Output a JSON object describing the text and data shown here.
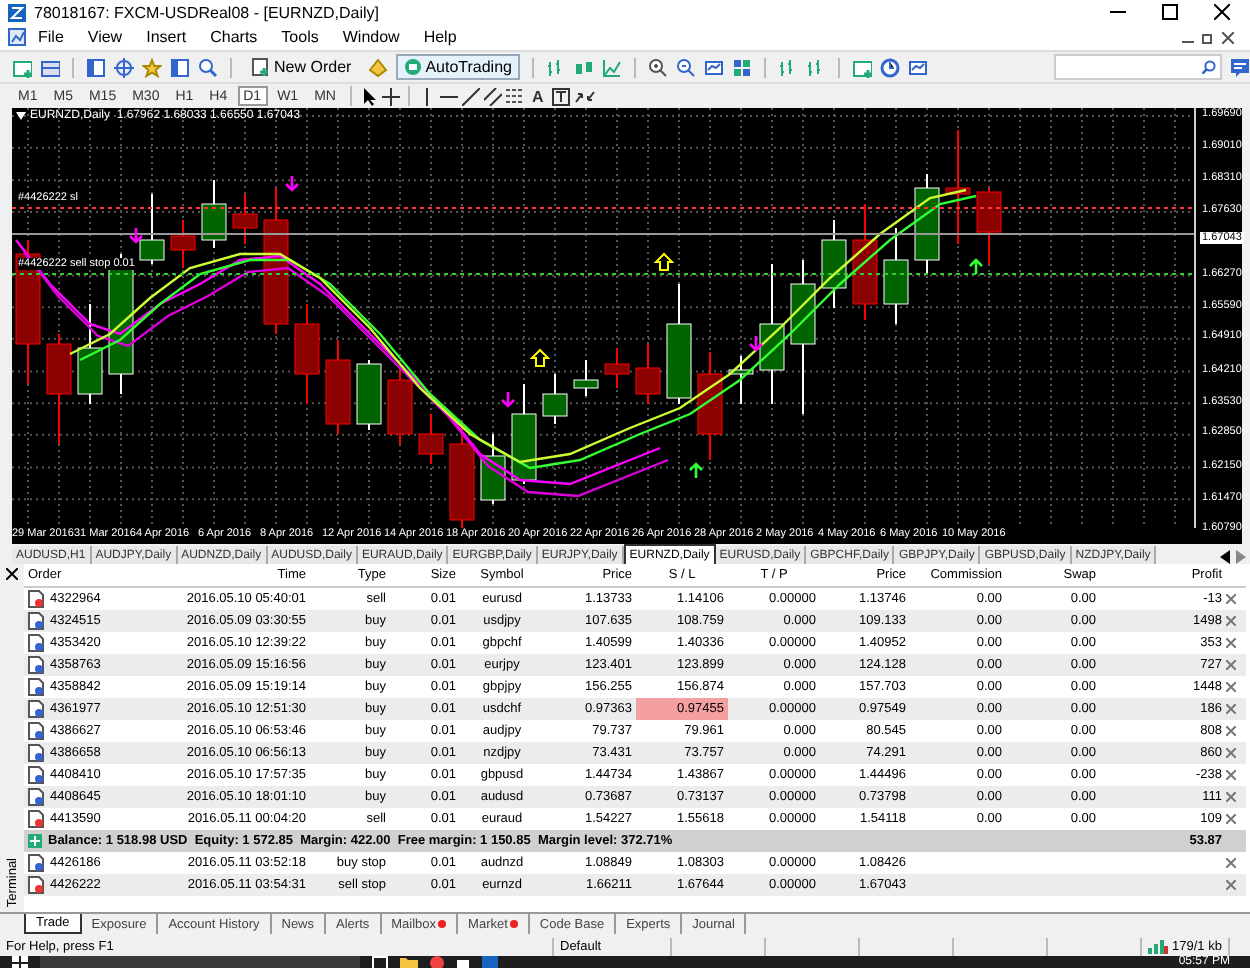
{
  "window": {
    "title": "78018167: FXCM-USDReal08 - [EURNZD,Daily]"
  },
  "menu": [
    "File",
    "View",
    "Insert",
    "Charts",
    "Tools",
    "Window",
    "Help"
  ],
  "toolbar": {
    "new_order": "New Order",
    "autotrading": "AutoTrading"
  },
  "timeframes": [
    {
      "label": "M1",
      "selected": false
    },
    {
      "label": "M5",
      "selected": false
    },
    {
      "label": "M15",
      "selected": false
    },
    {
      "label": "M30",
      "selected": false
    },
    {
      "label": "H1",
      "selected": false
    },
    {
      "label": "H4",
      "selected": false
    },
    {
      "label": "D1",
      "selected": true
    },
    {
      "label": "W1",
      "selected": false
    },
    {
      "label": "MN",
      "selected": false
    }
  ],
  "text_tool": "A",
  "chart": {
    "header": "EURNZD,Daily  1.67962 1.68033 1.66550 1.67043",
    "price_labels": [
      "1.69690",
      "1.69010",
      "1.68310",
      "1.67630",
      "1.66270",
      "1.65590",
      "1.64910",
      "1.64210",
      "1.63530",
      "1.62850",
      "1.62150",
      "1.61470",
      "1.60790"
    ],
    "current_price": "1.67043",
    "order_lines": [
      {
        "kind": "sl",
        "label": "#4426222 sl"
      },
      {
        "kind": "pending",
        "label": "#4426222 sell stop 0.01"
      }
    ],
    "date_labels": [
      "29 Mar 2016",
      "31 Mar 2016",
      "4 Apr 2016",
      "6 Apr 2016",
      "8 Apr 2016",
      "12 Apr 2016",
      "14 Apr 2016",
      "18 Apr 2016",
      "20 Apr 2016",
      "22 Apr 2016",
      "26 Apr 2016",
      "28 Apr 2016",
      "2 May 2016",
      "4 May 2016",
      "6 May 2016",
      "10 May 2016"
    ]
  },
  "chart_tabs": [
    {
      "label": "AUDUSD,H1",
      "selected": false
    },
    {
      "label": "AUDJPY,Daily",
      "selected": false
    },
    {
      "label": "AUDNZD,Daily",
      "selected": false
    },
    {
      "label": "AUDUSD,Daily",
      "selected": false
    },
    {
      "label": "EURAUD,Daily",
      "selected": false
    },
    {
      "label": "EURGBP,Daily",
      "selected": false
    },
    {
      "label": "EURJPY,Daily",
      "selected": false
    },
    {
      "label": "EURNZD,Daily",
      "selected": true
    },
    {
      "label": "EURUSD,Daily",
      "selected": false
    },
    {
      "label": "GBPCHF,Daily",
      "selected": false
    },
    {
      "label": "GBPJPY,Daily",
      "selected": false
    },
    {
      "label": "GBPUSD,Daily",
      "selected": false
    },
    {
      "label": "NZDJPY,Daily",
      "selected": false
    }
  ],
  "terminal": {
    "label": "Terminal",
    "columns": [
      "Order",
      "Time",
      "Type",
      "Size",
      "Symbol",
      "Price",
      "S / L",
      "T / P",
      "Price",
      "Commission",
      "Swap",
      "Profit"
    ],
    "rows": [
      {
        "kind": "sell",
        "sl_alert": false,
        "cells": [
          "4322964",
          "2016.05.10 05:40:01",
          "sell",
          "0.01",
          "eurusd",
          "1.13733",
          "1.14106",
          "0.00000",
          "1.13746",
          "0.00",
          "0.00",
          "-13"
        ]
      },
      {
        "kind": "buy",
        "sl_alert": false,
        "cells": [
          "4324515",
          "2016.05.09 03:30:55",
          "buy",
          "0.01",
          "usdjpy",
          "107.635",
          "108.759",
          "0.000",
          "109.133",
          "0.00",
          "0.00",
          "1498"
        ]
      },
      {
        "kind": "buy",
        "sl_alert": false,
        "cells": [
          "4353420",
          "2016.05.10 12:39:22",
          "buy",
          "0.01",
          "gbpchf",
          "1.40599",
          "1.40336",
          "0.00000",
          "1.40952",
          "0.00",
          "0.00",
          "353"
        ]
      },
      {
        "kind": "buy",
        "sl_alert": false,
        "cells": [
          "4358763",
          "2016.05.09 15:16:56",
          "buy",
          "0.01",
          "eurjpy",
          "123.401",
          "123.899",
          "0.000",
          "124.128",
          "0.00",
          "0.00",
          "727"
        ]
      },
      {
        "kind": "buy",
        "sl_alert": false,
        "cells": [
          "4358842",
          "2016.05.09 15:19:14",
          "buy",
          "0.01",
          "gbpjpy",
          "156.255",
          "156.874",
          "0.000",
          "157.703",
          "0.00",
          "0.00",
          "1448"
        ]
      },
      {
        "kind": "buy",
        "sl_alert": true,
        "cells": [
          "4361977",
          "2016.05.10 12:51:30",
          "buy",
          "0.01",
          "usdchf",
          "0.97363",
          "0.97455",
          "0.00000",
          "0.97549",
          "0.00",
          "0.00",
          "186"
        ]
      },
      {
        "kind": "buy",
        "sl_alert": false,
        "cells": [
          "4386627",
          "2016.05.10 06:53:46",
          "buy",
          "0.01",
          "audjpy",
          "79.737",
          "79.961",
          "0.000",
          "80.545",
          "0.00",
          "0.00",
          "808"
        ]
      },
      {
        "kind": "buy",
        "sl_alert": false,
        "cells": [
          "4386658",
          "2016.05.10 06:56:13",
          "buy",
          "0.01",
          "nzdjpy",
          "73.431",
          "73.757",
          "0.000",
          "74.291",
          "0.00",
          "0.00",
          "860"
        ]
      },
      {
        "kind": "buy",
        "sl_alert": false,
        "cells": [
          "4408410",
          "2016.05.10 17:57:35",
          "buy",
          "0.01",
          "gbpusd",
          "1.44734",
          "1.43867",
          "0.00000",
          "1.44496",
          "0.00",
          "0.00",
          "-238"
        ]
      },
      {
        "kind": "buy",
        "sl_alert": false,
        "cells": [
          "4408645",
          "2016.05.10 18:01:10",
          "buy",
          "0.01",
          "audusd",
          "0.73687",
          "0.73137",
          "0.00000",
          "0.73798",
          "0.00",
          "0.00",
          "111"
        ]
      },
      {
        "kind": "sell",
        "sl_alert": false,
        "cells": [
          "4413590",
          "2016.05.11 00:04:20",
          "sell",
          "0.01",
          "euraud",
          "1.54227",
          "1.55618",
          "0.00000",
          "1.54118",
          "0.00",
          "0.00",
          "109"
        ]
      }
    ],
    "balance": {
      "text": "Balance: 1 518.98 USD  Equity: 1 572.85  Margin: 422.00  Free margin: 1 150.85  Margin level: 372.71%",
      "profit": "53.87"
    },
    "pending_rows": [
      {
        "kind": "buy",
        "cells": [
          "4426186",
          "2016.05.11 03:52:18",
          "buy stop",
          "0.01",
          "audnzd",
          "1.08849",
          "1.08303",
          "0.00000",
          "1.08426"
        ]
      },
      {
        "kind": "sell",
        "cells": [
          "4426222",
          "2016.05.11 03:54:31",
          "sell stop",
          "0.01",
          "eurnzd",
          "1.66211",
          "1.67644",
          "0.00000",
          "1.67043"
        ]
      }
    ]
  },
  "terminal_tabs": [
    {
      "label": "Trade",
      "selected": true,
      "has_badge": false
    },
    {
      "label": "Exposure",
      "selected": false,
      "has_badge": false
    },
    {
      "label": "Account History",
      "selected": false,
      "has_badge": false
    },
    {
      "label": "News",
      "selected": false,
      "has_badge": false
    },
    {
      "label": "Alerts",
      "selected": false,
      "has_badge": false
    },
    {
      "label": "Mailbox",
      "selected": false,
      "has_badge": true
    },
    {
      "label": "Market",
      "selected": false,
      "has_badge": true
    },
    {
      "label": "Code Base",
      "selected": false,
      "has_badge": false
    },
    {
      "label": "Experts",
      "selected": false,
      "has_badge": false
    },
    {
      "label": "Journal",
      "selected": false,
      "has_badge": false
    }
  ],
  "status_bar": {
    "help": "For Help, press F1",
    "profile": "Default",
    "traffic": "179/1 kb"
  },
  "taskbar": {
    "time": "05:57 PM"
  }
}
